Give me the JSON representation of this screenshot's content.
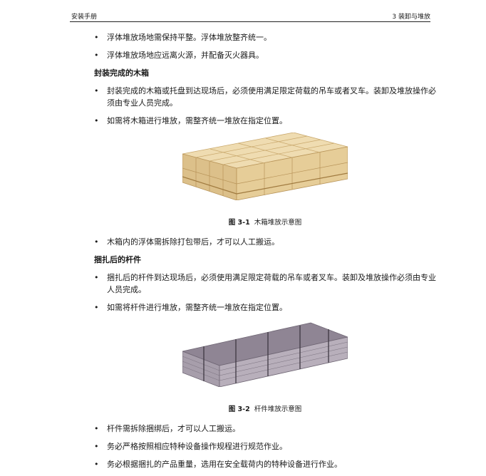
{
  "header": {
    "left": "安装手册",
    "right": "3 装卸与堆放"
  },
  "intro_bullets": [
    "浮体堆放场地需保持平整。浮体堆放整齐统一。",
    "浮体堆放场地应远离火源，并配备灭火器具。"
  ],
  "section1": {
    "title": "封装完成的木箱",
    "bullets": [
      "封装完成的木箱或托盘到达现场后，必须使用满足限定荷载的吊车或者叉车。装卸及堆放操作必须由专业人员完成。",
      "如需将木箱进行堆放，需整齐统一堆放在指定位置。"
    ],
    "figure": {
      "number": "图 3-1",
      "caption": "木箱堆放示意图"
    },
    "after_bullets": [
      "木箱内的浮体需拆除打包带后，才可以人工搬运。"
    ]
  },
  "section2": {
    "title": "捆扎后的杆件",
    "bullets": [
      "捆扎后的杆件到达现场后，必须使用满足限定荷载的吊车或者叉车。装卸及堆放操作必须由专业人员完成。",
      "如需将杆件进行堆放，需整齐统一堆放在指定位置。"
    ],
    "figure": {
      "number": "图 3-2",
      "caption": "杆件堆放示意图"
    },
    "after_bullets": [
      "杆件需拆除捆绑后，才可以人工搬运。",
      "务必严格按照相应特种设备操作规程进行规范作业。",
      "务必根据捆扎的产品重量，选用在安全载荷内的特种设备进行作业。"
    ]
  },
  "colors": {
    "crate_top": "#efdcb1",
    "crate_front": "#dcc08a",
    "crate_side": "#c9a86c",
    "rod_top": "#8a7f8d",
    "rod_front": "#b3a9b6"
  }
}
